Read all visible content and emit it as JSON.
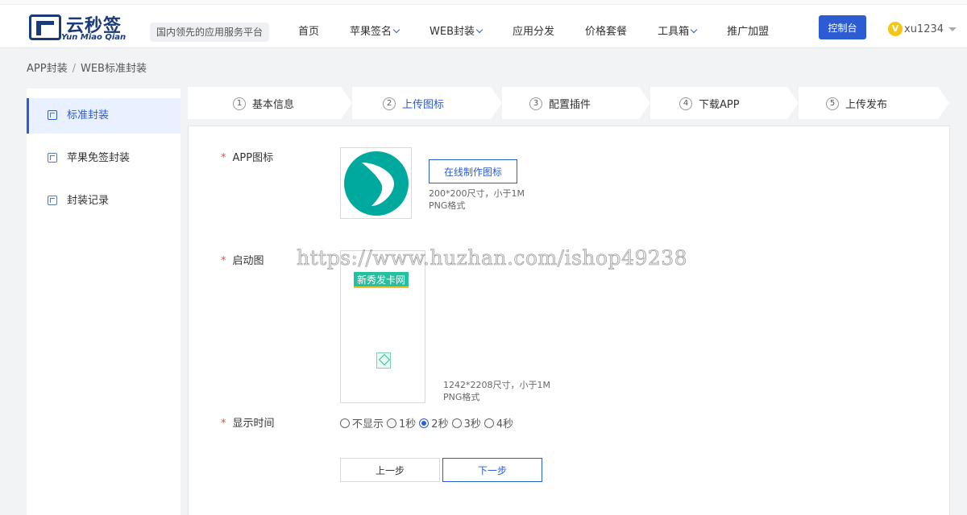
{
  "header": {
    "logo_cn": "云秒签",
    "logo_en": "Yun Miao Qian",
    "slogan": "国内领先的应用服务平台",
    "nav": [
      {
        "label": "首页",
        "has_dropdown": false
      },
      {
        "label": "苹果签名",
        "has_dropdown": true
      },
      {
        "label": "WEB封装",
        "has_dropdown": true
      },
      {
        "label": "应用分发",
        "has_dropdown": false
      },
      {
        "label": "价格套餐",
        "has_dropdown": false
      },
      {
        "label": "工具箱",
        "has_dropdown": true
      },
      {
        "label": "推广加盟",
        "has_dropdown": false
      }
    ],
    "console_label": "控制台",
    "vip_badge": "V",
    "username": "xu1234"
  },
  "breadcrumb": {
    "items": [
      "APP封装",
      "WEB标准封装"
    ],
    "separator": "/"
  },
  "sidebar": {
    "items": [
      {
        "label": "标准封装",
        "active": true,
        "icon": "cube-icon"
      },
      {
        "label": "苹果免签封装",
        "active": false,
        "icon": "cube-icon"
      },
      {
        "label": "封装记录",
        "active": false,
        "icon": "cube-icon"
      }
    ]
  },
  "steps": [
    {
      "num": "1",
      "label": "基本信息",
      "active": false
    },
    {
      "num": "2",
      "label": "上传图标",
      "active": true
    },
    {
      "num": "3",
      "label": "配置插件",
      "active": false
    },
    {
      "num": "4",
      "label": "下载APP",
      "active": false
    },
    {
      "num": "5",
      "label": "上传发布",
      "active": false
    }
  ],
  "form": {
    "required_mark": "*",
    "app_icon": {
      "label": "APP图标",
      "make_button": "在线制作图标",
      "hint_size": "200*200尺寸，小于1M",
      "hint_format": "PNG格式"
    },
    "splash": {
      "label": "启动图",
      "badge_text": "新秀发卡网",
      "hint_size": "1242*2208尺寸，小于1M",
      "hint_format": "PNG格式"
    },
    "display_time": {
      "label": "显示时间",
      "options": [
        "不显示",
        "1秒",
        "2秒",
        "3秒",
        "4秒"
      ],
      "selected": "2秒"
    },
    "prev_button": "上一步",
    "next_button": "下一步"
  },
  "watermark": "https://www.huzhan.com/ishop49238",
  "colors": {
    "accent": "#2d5bd1",
    "brand": "#1a3a7a",
    "app_logo": "#00a99d",
    "required": "#e84a3a"
  }
}
